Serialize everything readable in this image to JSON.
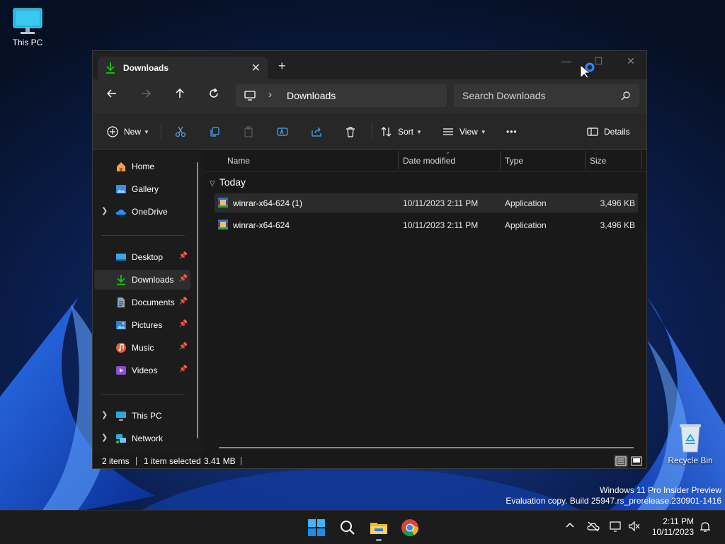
{
  "desktop": {
    "icons": [
      {
        "label": "This PC"
      },
      {
        "label": "Recycle Bin"
      }
    ],
    "watermark": {
      "line1": "Windows 11 Pro Insider Preview",
      "line2": "Evaluation copy. Build 25947.rs_prerelease.230901-1416"
    }
  },
  "window": {
    "tab": {
      "label": "Downloads",
      "icon": "download-icon",
      "close": "✕"
    },
    "new_tab": "+",
    "controls": {
      "minimize": "—",
      "maximize": "☐",
      "close": "✕"
    },
    "address": {
      "location": "Downloads",
      "separator": "›"
    },
    "search": {
      "placeholder": "Search Downloads"
    },
    "commands": {
      "new": "New",
      "sort": "Sort",
      "view": "View",
      "more": "•••",
      "details": "Details"
    },
    "sidebar": {
      "items": [
        {
          "label": "Home",
          "icon": "home-icon"
        },
        {
          "label": "Gallery",
          "icon": "gallery-icon"
        },
        {
          "label": "OneDrive",
          "icon": "cloud-icon"
        },
        {
          "label": "Desktop",
          "icon": "desktop-icon"
        },
        {
          "label": "Downloads",
          "icon": "download-icon"
        },
        {
          "label": "Documents",
          "icon": "document-icon"
        },
        {
          "label": "Pictures",
          "icon": "pictures-icon"
        },
        {
          "label": "Music",
          "icon": "music-icon"
        },
        {
          "label": "Videos",
          "icon": "videos-icon"
        },
        {
          "label": "This PC",
          "icon": "computer-icon"
        },
        {
          "label": "Network",
          "icon": "network-icon"
        }
      ]
    },
    "columns": {
      "name": "Name",
      "date": "Date modified",
      "type": "Type",
      "size": "Size"
    },
    "group": {
      "label": "Today"
    },
    "files": [
      {
        "name": "winrar-x64-624 (1)",
        "date": "10/11/2023 2:11 PM",
        "type": "Application",
        "size": "3,496 KB"
      },
      {
        "name": "winrar-x64-624",
        "date": "10/11/2023 2:11 PM",
        "type": "Application",
        "size": "3,496 KB"
      }
    ],
    "status": {
      "count": "2 items",
      "selection": "1 item selected",
      "selection_size": "3.41 MB"
    }
  },
  "taskbar": {
    "clock_time": "2:11 PM",
    "clock_date": "10/11/2023"
  },
  "colors": {
    "accent_green": "#16c60c",
    "window_bg": "#191919",
    "taskbar_bg": "#1c1c1c"
  }
}
